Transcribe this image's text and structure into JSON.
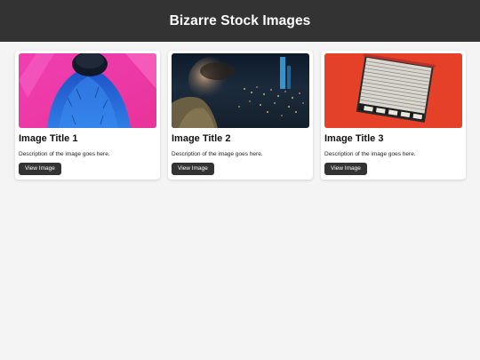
{
  "header": {
    "title": "Bizarre Stock Images"
  },
  "cards": [
    {
      "title": "Image Title 1",
      "description": "Description of the image goes here.",
      "button_label": "View Image",
      "image_icon": "blue-feather-figure-on-pink-wall-photo"
    },
    {
      "title": "Image Title 2",
      "description": "Description of the image goes here.",
      "button_label": "View Image",
      "image_icon": "person-over-night-city-photo"
    },
    {
      "title": "Image Title 3",
      "description": "Description of the image goes here.",
      "button_label": "View Image",
      "image_icon": "rolling-shutter-window-on-red-wall-photo"
    }
  ],
  "colors": {
    "header_bg": "#333333",
    "page_bg": "#f4f4f4",
    "card_bg": "#ffffff",
    "button_bg": "#333333",
    "button_text": "#ffffff"
  }
}
